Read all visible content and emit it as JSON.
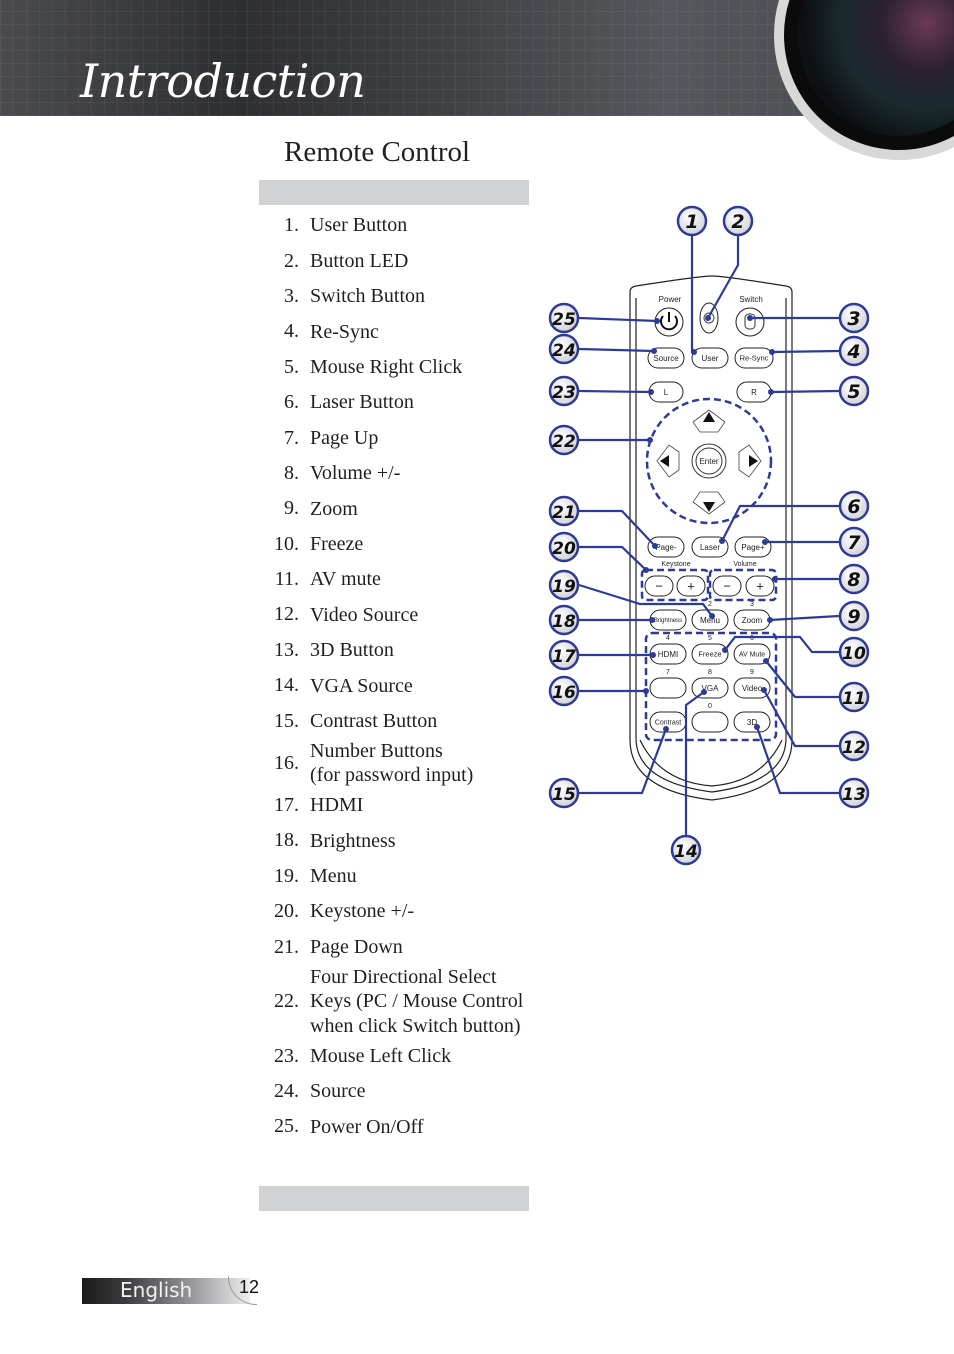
{
  "header": {
    "title": "Introduction"
  },
  "section": {
    "title": "Remote Control"
  },
  "items": [
    {
      "num": "1.",
      "label": "User Button"
    },
    {
      "num": "2.",
      "label": "Button LED"
    },
    {
      "num": "3.",
      "label": "Switch Button"
    },
    {
      "num": "4.",
      "label": "Re-Sync"
    },
    {
      "num": "5.",
      "label": "Mouse Right Click"
    },
    {
      "num": "6.",
      "label": "Laser Button"
    },
    {
      "num": "7.",
      "label": "Page Up"
    },
    {
      "num": "8.",
      "label": "Volume +/-"
    },
    {
      "num": "9.",
      "label": "Zoom"
    },
    {
      "num": "10.",
      "label": "Freeze"
    },
    {
      "num": "11.",
      "label": "AV mute"
    },
    {
      "num": "12.",
      "label": "Video Source"
    },
    {
      "num": "13.",
      "label": "3D Button"
    },
    {
      "num": "14.",
      "label": "VGA Source"
    },
    {
      "num": "15.",
      "label": "Contrast Button"
    },
    {
      "num": "16.",
      "label": "Number Buttons\n(for password input)"
    },
    {
      "num": "17.",
      "label": "HDMI"
    },
    {
      "num": "18.",
      "label": "Brightness"
    },
    {
      "num": "19.",
      "label": "Menu"
    },
    {
      "num": "20.",
      "label": "Keystone +/-"
    },
    {
      "num": "21.",
      "label": "Page Down"
    },
    {
      "num": "22.",
      "label": "Four Directional Select Keys (PC / Mouse Control when click Switch button)"
    },
    {
      "num": "23.",
      "label": "Mouse Left Click"
    },
    {
      "num": "24.",
      "label": "Source"
    },
    {
      "num": "25.",
      "label": "Power On/Off"
    }
  ],
  "remote": {
    "top_labels": {
      "power": "Power",
      "switch": "Switch"
    },
    "buttons": {
      "source": "Source",
      "user": "User",
      "resync": "Re-Sync",
      "left": "L",
      "right": "R",
      "enter": "Enter",
      "page_down": "Page-",
      "laser": "Laser",
      "page_up": "Page+",
      "keystone": "Keystone",
      "volume": "Volume",
      "minus": "−",
      "plus": "+",
      "brightness": "Brightness",
      "menu": "Menu",
      "zoom": "Zoom",
      "hdmi": "HDMI",
      "freeze": "Freeze",
      "av_mute": "AV Mute",
      "vga": "VGA",
      "video": "Video",
      "contrast": "Contrast",
      "threed": "3D"
    },
    "digits": {
      "d2": "2",
      "d3": "3",
      "d4": "4",
      "d5": "5",
      "d6": "6",
      "d7": "7",
      "d8": "8",
      "d9": "9",
      "d0": "0"
    },
    "callouts": [
      "1",
      "2",
      "3",
      "4",
      "5",
      "6",
      "7",
      "8",
      "9",
      "10",
      "11",
      "12",
      "13",
      "14",
      "15",
      "16",
      "17",
      "18",
      "19",
      "20",
      "21",
      "22",
      "23",
      "24",
      "25"
    ],
    "accent_color": "#2e3a97"
  },
  "footer": {
    "language": "English",
    "page": "12"
  }
}
